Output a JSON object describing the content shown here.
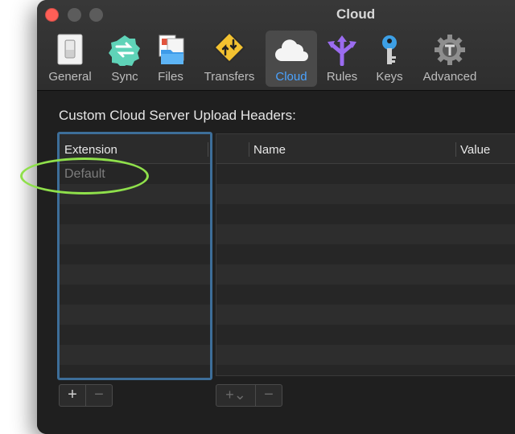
{
  "window": {
    "title": "Cloud"
  },
  "toolbar": {
    "items": [
      {
        "label": "General",
        "icon": "general-switch-icon"
      },
      {
        "label": "Sync",
        "icon": "sync-arrows-icon"
      },
      {
        "label": "Files",
        "icon": "files-icon"
      },
      {
        "label": "Transfers",
        "icon": "transfers-road-sign-icon"
      },
      {
        "label": "Cloud",
        "icon": "cloud-icon",
        "selected": true
      },
      {
        "label": "Rules",
        "icon": "rules-arrows-icon"
      },
      {
        "label": "Keys",
        "icon": "key-icon"
      },
      {
        "label": "Advanced",
        "icon": "gear-icon"
      }
    ]
  },
  "section": {
    "title": "Custom Cloud Server Upload Headers:"
  },
  "extensions_table": {
    "header": "Extension",
    "rows": [
      "Default"
    ]
  },
  "headers_table": {
    "columns": [
      "Name",
      "Value"
    ]
  },
  "buttons": {
    "add": "+",
    "remove": "−",
    "add_menu": "+⌄"
  },
  "colors": {
    "accent": "#4aa3ff",
    "selection_border": "#3d6e99",
    "annotation": "#8fe04b",
    "close": "#fe5f57"
  }
}
